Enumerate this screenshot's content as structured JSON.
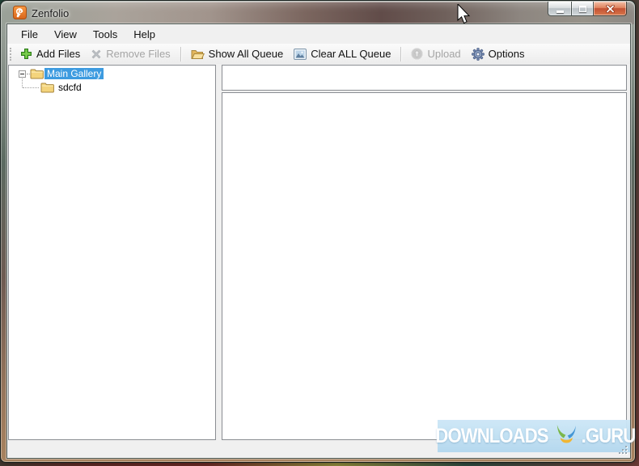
{
  "window": {
    "title": "Zenfolio"
  },
  "menu": {
    "items": [
      {
        "label": "File"
      },
      {
        "label": "View"
      },
      {
        "label": "Tools"
      },
      {
        "label": "Help"
      }
    ]
  },
  "toolbar": {
    "buttons": [
      {
        "label": "Add Files",
        "icon": "add-plus-icon",
        "enabled": true
      },
      {
        "label": "Remove Files",
        "icon": "remove-x-icon",
        "enabled": false
      },
      {
        "label": "Show All Queue",
        "icon": "open-folder-icon",
        "enabled": true
      },
      {
        "label": "Clear ALL Queue",
        "icon": "picture-icon",
        "enabled": true
      },
      {
        "label": "Upload",
        "icon": "upload-globe-icon",
        "enabled": false
      },
      {
        "label": "Options",
        "icon": "gear-icon",
        "enabled": true
      }
    ]
  },
  "tree": {
    "items": [
      {
        "label": "Main Gallery",
        "level": 0,
        "selected": true,
        "expanded": true
      },
      {
        "label": "sdcfd",
        "level": 1,
        "selected": false
      }
    ]
  },
  "watermark": {
    "left": "DOWNLOADS",
    "right": ".GURU"
  },
  "colors": {
    "selection_blue": "#3d9be0",
    "banner_bg": "#b9dcf0",
    "close_button_red": "#c35134",
    "zenfolio_orange": "#e87b1e",
    "add_green": "#56b22e"
  }
}
